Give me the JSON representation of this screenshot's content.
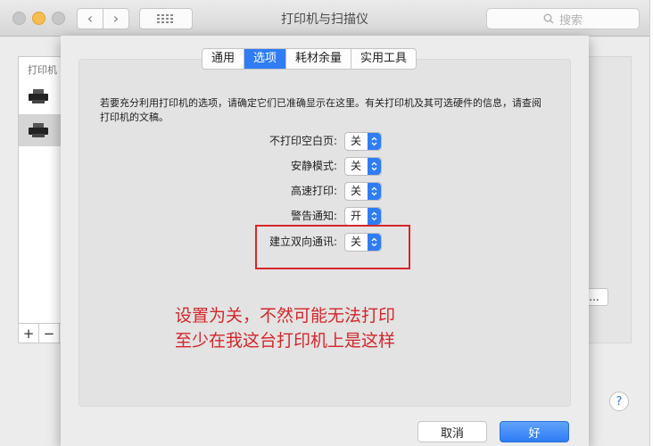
{
  "window": {
    "title": "打印机与扫描仪"
  },
  "search": {
    "placeholder": "搜索"
  },
  "printers_pane": {
    "title": "打印机",
    "add_label": "+",
    "remove_label": "−"
  },
  "right_pane": {
    "more_label": "..."
  },
  "help": {
    "label": "?"
  },
  "tabs": [
    {
      "label": "通用",
      "active": false
    },
    {
      "label": "选项",
      "active": true
    },
    {
      "label": "耗材余量",
      "active": false
    },
    {
      "label": "实用工具",
      "active": false
    }
  ],
  "description": "若要充分利用打印机的选项，请确定它们已准确显示在这里。有关打印机及其可选硬件的信息，请查阅打印机的文稿。",
  "options": [
    {
      "label": "不打印空白页:",
      "value": "关"
    },
    {
      "label": "安静模式:",
      "value": "关"
    },
    {
      "label": "高速打印:",
      "value": "关"
    },
    {
      "label": "警告通知:",
      "value": "开"
    },
    {
      "label": "建立双向通讯:",
      "value": "关"
    }
  ],
  "annotation": {
    "line1": "设置为关，不然可能无法打印",
    "line2": "至少在我这台打印机上是这样",
    "color": "#d5262b"
  },
  "buttons": {
    "cancel": "取消",
    "ok": "好"
  },
  "colors": {
    "accent": "#2f7cf6"
  }
}
